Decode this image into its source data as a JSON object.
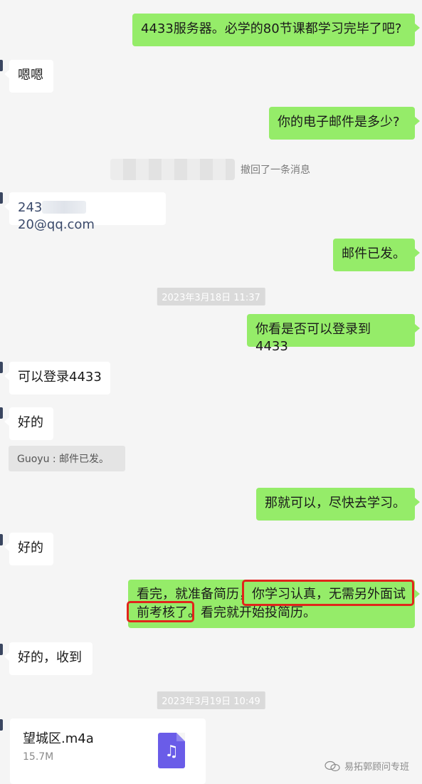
{
  "messages": {
    "m1": "4433服务器。必学的80节课都学习完毕了吧?",
    "m2": "嗯嗯",
    "m3": "你的电子邮件是多少?",
    "recall": "撤回了一条消息",
    "email_prefix": "243",
    "email_suffix": "20@qq.com",
    "m5": "邮件已发。",
    "ts1": "2023年3月18日 11:37",
    "m6": "你看是否可以登录到 4433",
    "m7": "可以登录4433",
    "m8": "好的",
    "quote": "Guoyu : 邮件已发。",
    "m9": "那就可以，尽快去学习。",
    "m10": "好的",
    "m11_line1": "看完，就准备简历，你学习认真，无需另外面试",
    "m11_line2": "前考核了。看完就开始投简历。",
    "m12": "好的，收到",
    "ts2": "2023年3月19日 10:49"
  },
  "file": {
    "name": "望城区.m4a",
    "size": "15.7M",
    "icon": "music-file-icon"
  },
  "watermark": "易拓郭顾问专班",
  "colors": {
    "sent_bubble": "#95ec69",
    "received_bubble": "#ffffff",
    "background": "#f5f5f5",
    "highlight": "#e1251b"
  }
}
